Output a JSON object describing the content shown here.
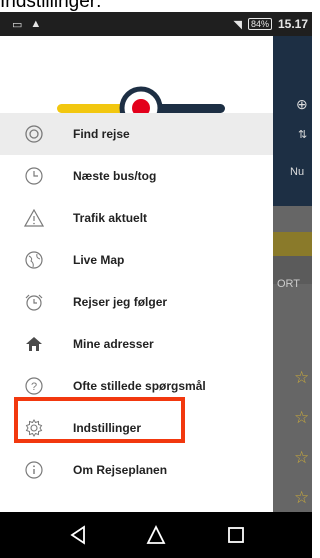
{
  "caption": "Indstillinger:",
  "status_bar": {
    "time": "15.17",
    "battery": "84%",
    "left_icons": [
      "notification-icon",
      "image-icon"
    ],
    "right_icons": [
      "wifi-icon",
      "signal-icon",
      "battery-icon"
    ]
  },
  "menu": {
    "items": [
      {
        "label": "Find rejse",
        "icon": "target-icon",
        "active": true
      },
      {
        "label": "Næste bus/tog",
        "icon": "clock-icon",
        "active": false
      },
      {
        "label": "Trafik aktuelt",
        "icon": "warning-icon",
        "active": false
      },
      {
        "label": "Live Map",
        "icon": "globe-icon",
        "active": false
      },
      {
        "label": "Rejser jeg følger",
        "icon": "alarm-clock-icon",
        "active": false
      },
      {
        "label": "Mine adresser",
        "icon": "home-icon",
        "active": false
      },
      {
        "label": "Ofte stillede spørgsmål",
        "icon": "question-icon",
        "active": false
      },
      {
        "label": "Indstillinger",
        "icon": "gear-icon",
        "active": false
      },
      {
        "label": "Om Rejseplanen",
        "icon": "info-icon",
        "active": false
      }
    ],
    "highlighted_item": "Indstillinger"
  },
  "background": {
    "partial_texts": [
      "Nu",
      "ORT"
    ]
  },
  "nav_bar": {
    "buttons": [
      "back-icon",
      "home-icon",
      "recents-icon"
    ]
  },
  "colors": {
    "brand_yellow": "#f2c70f",
    "brand_navy": "#1d2f44",
    "brand_red": "#e3001b",
    "highlight_red": "#f2380e",
    "active_row": "#ececec"
  }
}
